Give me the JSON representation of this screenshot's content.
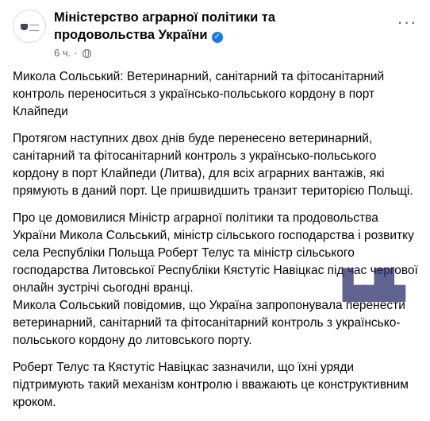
{
  "post": {
    "page_name": "Міністерство аграрної політики та продовольства України",
    "timestamp": "6 ч.",
    "separator": "·",
    "more_label": "···",
    "verified_glyph": "✓",
    "paragraphs": [
      "Микола Сольський: Ветеринарний, санітарний та фітосанітарний контроль переноситься з українсько-польського кордону в порт Клайпеди",
      "Протягом наступних двох днів буде перенесено ветеринарний, санітарний та фітосанітарний контроль з українсько-польського кордону в порт Клайпеди (Литва), для всіх аграрних вантажів, які прямують в даний порт. Це пришвидшить транзит територією Польщі.",
      "Про це домовилися Міністр аграрної політики та продовольства України Микола Сольський, міністр сільського господарства і розвитку села Республіки Польща Роберт Телус та міністр сільського господарства Литовської Республіки Кястутіс Навіцкас під час чергової онлайн зустрічі сьогодні вранці.",
      "Микола Сольський повідомив, що Україна запропонувала перенести ветеринарний, санітарний та фітосанітарний контроль з українсько-польського кордону до литовського порту.",
      "Роберт Телус та Кястутіс Навіцкас зазначили, що їхні уряди підтримують такий механізм контролю і вважають це конструктивним кроком."
    ]
  },
  "icons": {
    "avatar": "ministry-emblem-icon",
    "verified": "verified-badge-icon",
    "audience": "globe-icon",
    "more": "more-options-icon"
  },
  "colors": {
    "text": "#050505",
    "secondary": "#65676b",
    "verified": "#1877f2"
  }
}
